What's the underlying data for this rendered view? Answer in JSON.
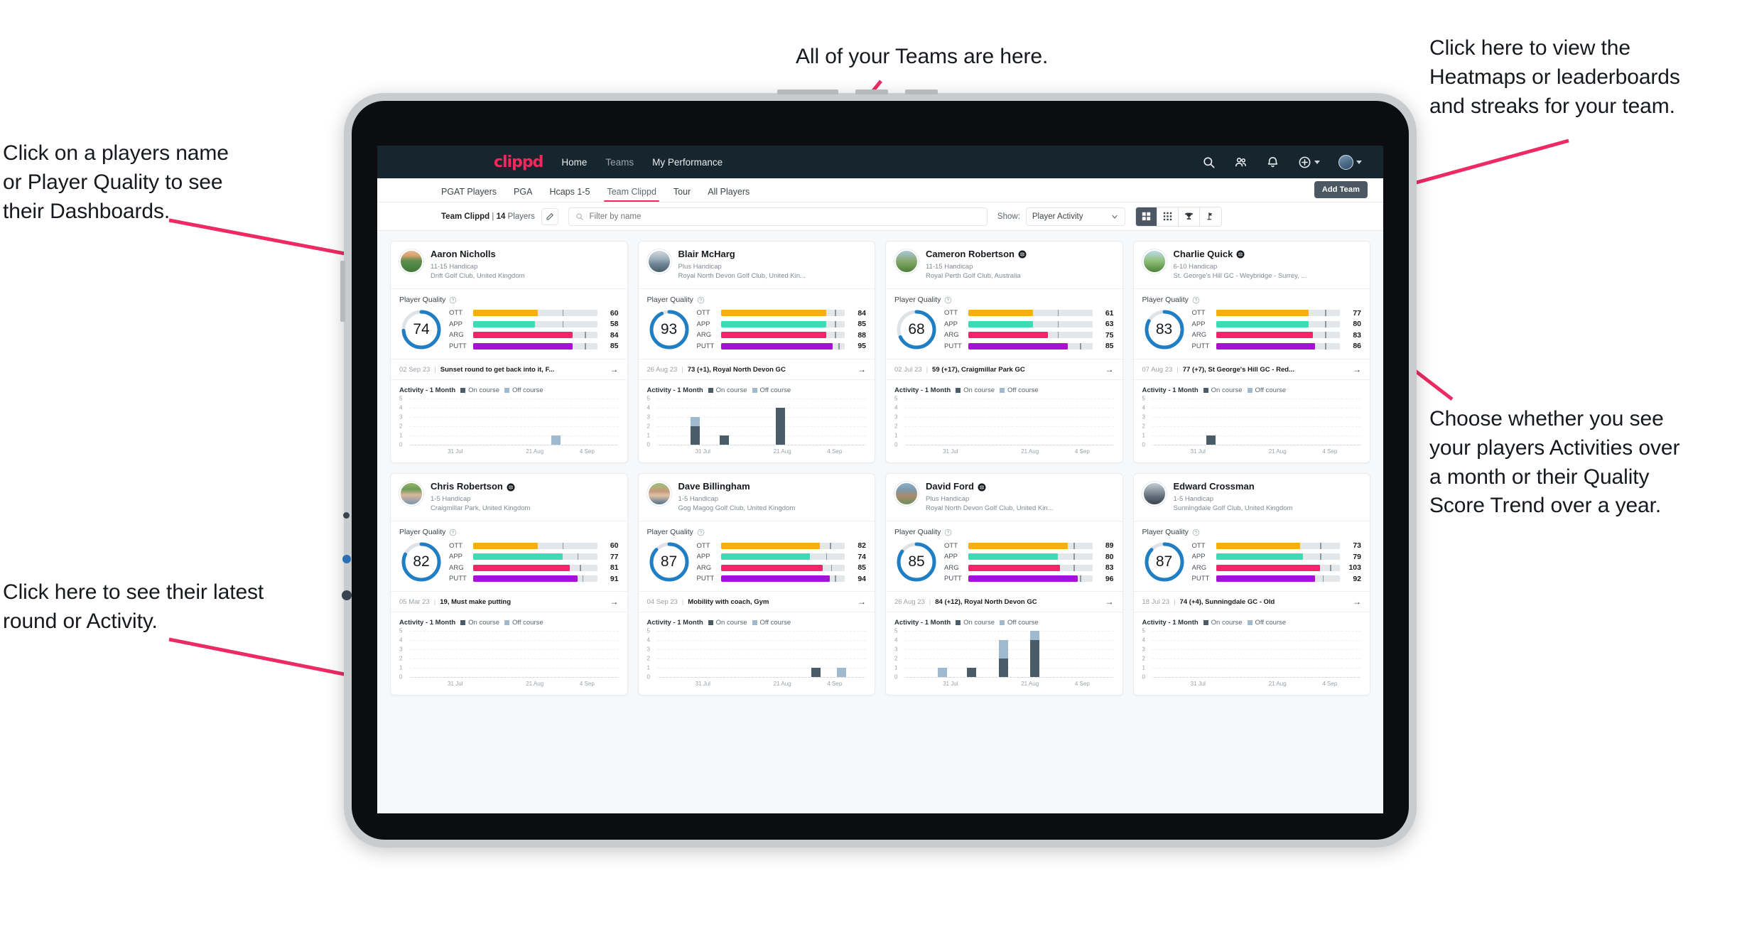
{
  "annotations": [
    {
      "id": "players-name",
      "text": "Click on a players name\nor Player Quality to see\ntheir Dashboards."
    },
    {
      "id": "teams",
      "text": "All of your Teams are here."
    },
    {
      "id": "heatmaps",
      "text": "Click here to view the\nHeatmaps or leaderboards\nand streaks for your team."
    },
    {
      "id": "activity-choice",
      "text": "Choose whether you see\nyour players Activities over\na month or their Quality\nScore Trend over a year."
    },
    {
      "id": "latest-round",
      "text": "Click here to see their latest\nround or Activity."
    }
  ],
  "topnav": {
    "brand": "clippd",
    "links": [
      {
        "label": "Home",
        "active": true
      },
      {
        "label": "Teams",
        "active": false
      },
      {
        "label": "My Performance",
        "active": true
      }
    ],
    "icons": [
      "search-icon",
      "people-icon",
      "bell-icon",
      "add-circle-icon"
    ],
    "avatar": "user-avatar"
  },
  "subnav": {
    "tabs": [
      {
        "label": "PGAT Players",
        "active": false
      },
      {
        "label": "PGA",
        "active": false
      },
      {
        "label": "Hcaps 1-5",
        "active": false
      },
      {
        "label": "Team Clippd",
        "active": true
      },
      {
        "label": "Tour",
        "active": false
      },
      {
        "label": "All Players",
        "active": false
      }
    ],
    "add_team_label": "Add Team"
  },
  "filterbar": {
    "team_name": "Team Clippd",
    "separator": "|",
    "player_count": "14",
    "players_word": "Players",
    "edit_icon": "pencil-icon",
    "search_placeholder": "Filter by name",
    "search_value": "",
    "show_label": "Show:",
    "show_value": "Player Activity",
    "show_options": [
      "Player Activity",
      "Quality Score Trend"
    ],
    "view_buttons": [
      {
        "icon": "grid-large-icon",
        "active": true
      },
      {
        "icon": "grid-dense-icon",
        "active": false
      },
      {
        "icon": "trophy-icon",
        "active": false
      },
      {
        "icon": "heatmap-flag-icon",
        "active": false
      }
    ]
  },
  "card_labels": {
    "player_quality": "Player Quality",
    "activity": "Activity - 1 Month",
    "legend_on": "On course",
    "legend_off": "Off course",
    "metrics": [
      "OTT",
      "APP",
      "ARG",
      "PUTT"
    ],
    "x_ticks": [
      "31 Jul",
      "21 Aug",
      "4 Sep"
    ],
    "y_ticks": [
      "5",
      "4",
      "3",
      "2",
      "1",
      "0"
    ],
    "arrow": "→"
  },
  "colors": {
    "brand_pink": "#f2285e",
    "navy": "#17252f",
    "ring_blue": "#1f7ec4",
    "ott": "#f9ad0e",
    "app": "#3ddbb4",
    "arg": "#f5246a",
    "putt": "#a90fd6",
    "on_course": "#4a5c68",
    "off_course": "#9fb9ce"
  },
  "players": [
    {
      "name": "Aaron Nicholls",
      "verified": false,
      "handicap": "11-15 Handicap",
      "club": "Drift Golf Club, United Kingdom",
      "quality": 74,
      "metrics": [
        {
          "key": "OTT",
          "value": 60,
          "fill": 52,
          "tick": 72
        },
        {
          "key": "APP",
          "value": 58,
          "fill": 50,
          "tick": 72
        },
        {
          "key": "ARG",
          "value": 84,
          "fill": 80,
          "tick": 90
        },
        {
          "key": "PUTT",
          "value": 85,
          "fill": 80,
          "tick": 90
        }
      ],
      "round_date": "02 Sep 23",
      "round_text": "Sunset round to get back into it, F...",
      "chart": {
        "bars": [
          {
            "x": 68,
            "on": 0,
            "off": 1
          }
        ]
      }
    },
    {
      "name": "Blair McHarg",
      "verified": false,
      "handicap": "Plus Handicap",
      "club": "Royal North Devon Golf Club, United Kin...",
      "quality": 93,
      "metrics": [
        {
          "key": "OTT",
          "value": 84,
          "fill": 85,
          "tick": 92
        },
        {
          "key": "APP",
          "value": 85,
          "fill": 85,
          "tick": 92
        },
        {
          "key": "ARG",
          "value": 88,
          "fill": 85,
          "tick": 92
        },
        {
          "key": "PUTT",
          "value": 95,
          "fill": 90,
          "tick": 95
        }
      ],
      "round_date": "26 Aug 23",
      "round_text": "73 (+1), Royal North Devon GC",
      "chart": {
        "bars": [
          {
            "x": 16,
            "on": 2,
            "off": 1
          },
          {
            "x": 30,
            "on": 1,
            "off": 0
          },
          {
            "x": 57,
            "on": 4,
            "off": 0
          }
        ]
      }
    },
    {
      "name": "Cameron Robertson",
      "verified": true,
      "handicap": "11-15 Handicap",
      "club": "Royal Perth Golf Club, Australia",
      "quality": 68,
      "metrics": [
        {
          "key": "OTT",
          "value": 61,
          "fill": 52,
          "tick": 72
        },
        {
          "key": "APP",
          "value": 63,
          "fill": 52,
          "tick": 72
        },
        {
          "key": "ARG",
          "value": 75,
          "fill": 64,
          "tick": 72
        },
        {
          "key": "PUTT",
          "value": 85,
          "fill": 80,
          "tick": 90
        }
      ],
      "round_date": "02 Jul 23",
      "round_text": "59 (+17), Craigmillar Park GC",
      "chart": {
        "bars": []
      }
    },
    {
      "name": "Charlie Quick",
      "verified": true,
      "handicap": "6-10 Handicap",
      "club": "St. George's Hill GC - Weybridge - Surrey, ...",
      "quality": 83,
      "metrics": [
        {
          "key": "OTT",
          "value": 77,
          "fill": 75,
          "tick": 88
        },
        {
          "key": "APP",
          "value": 80,
          "fill": 75,
          "tick": 88
        },
        {
          "key": "ARG",
          "value": 83,
          "fill": 78,
          "tick": 88
        },
        {
          "key": "PUTT",
          "value": 86,
          "fill": 80,
          "tick": 88
        }
      ],
      "round_date": "07 Aug 23",
      "round_text": "77 (+7), St George's Hill GC - Red...",
      "chart": {
        "bars": [
          {
            "x": 26,
            "on": 1,
            "off": 0
          }
        ]
      }
    },
    {
      "name": "Chris Robertson",
      "verified": true,
      "handicap": "1-5 Handicap",
      "club": "Craigmillar Park, United Kingdom",
      "quality": 82,
      "metrics": [
        {
          "key": "OTT",
          "value": 60,
          "fill": 52,
          "tick": 72
        },
        {
          "key": "APP",
          "value": 77,
          "fill": 72,
          "tick": 84
        },
        {
          "key": "ARG",
          "value": 81,
          "fill": 78,
          "tick": 86
        },
        {
          "key": "PUTT",
          "value": 91,
          "fill": 84,
          "tick": 88
        }
      ],
      "round_date": "05 Mar 23",
      "round_text": "19, Must make putting",
      "chart": {
        "bars": []
      }
    },
    {
      "name": "Dave Billingham",
      "verified": false,
      "handicap": "1-5 Handicap",
      "club": "Gog Magog Golf Club, United Kingdom",
      "quality": 87,
      "metrics": [
        {
          "key": "OTT",
          "value": 82,
          "fill": 80,
          "tick": 88
        },
        {
          "key": "APP",
          "value": 74,
          "fill": 72,
          "tick": 85
        },
        {
          "key": "ARG",
          "value": 85,
          "fill": 82,
          "tick": 89
        },
        {
          "key": "PUTT",
          "value": 94,
          "fill": 88,
          "tick": 92
        }
      ],
      "round_date": "04 Sep 23",
      "round_text": "Mobility with coach, Gym",
      "chart": {
        "bars": [
          {
            "x": 74,
            "on": 1,
            "off": 0
          },
          {
            "x": 86,
            "on": 0,
            "off": 1
          }
        ]
      }
    },
    {
      "name": "David Ford",
      "verified": true,
      "handicap": "Plus Handicap",
      "club": "Royal North Devon Golf Club, United Kin...",
      "quality": 85,
      "metrics": [
        {
          "key": "OTT",
          "value": 89,
          "fill": 80,
          "tick": 85
        },
        {
          "key": "APP",
          "value": 80,
          "fill": 72,
          "tick": 85
        },
        {
          "key": "ARG",
          "value": 83,
          "fill": 74,
          "tick": 85
        },
        {
          "key": "PUTT",
          "value": 96,
          "fill": 88,
          "tick": 90
        }
      ],
      "round_date": "26 Aug 23",
      "round_text": "84 (+12), Royal North Devon GC",
      "chart": {
        "bars": [
          {
            "x": 16,
            "on": 0,
            "off": 1
          },
          {
            "x": 30,
            "on": 1,
            "off": 0
          },
          {
            "x": 45,
            "on": 2,
            "off": 2
          },
          {
            "x": 60,
            "on": 4,
            "off": 1
          }
        ]
      }
    },
    {
      "name": "Edward Crossman",
      "verified": false,
      "handicap": "1-5 Handicap",
      "club": "Sunningdale Golf Club, United Kingdom",
      "quality": 87,
      "metrics": [
        {
          "key": "OTT",
          "value": 73,
          "fill": 68,
          "tick": 84
        },
        {
          "key": "APP",
          "value": 79,
          "fill": 70,
          "tick": 84
        },
        {
          "key": "ARG",
          "value": 103,
          "fill": 84,
          "tick": 92
        },
        {
          "key": "PUTT",
          "value": 92,
          "fill": 80,
          "tick": 86
        }
      ],
      "round_date": "18 Jul 23",
      "round_text": "74 (+4), Sunningdale GC - Old",
      "chart": {
        "bars": []
      }
    }
  ]
}
